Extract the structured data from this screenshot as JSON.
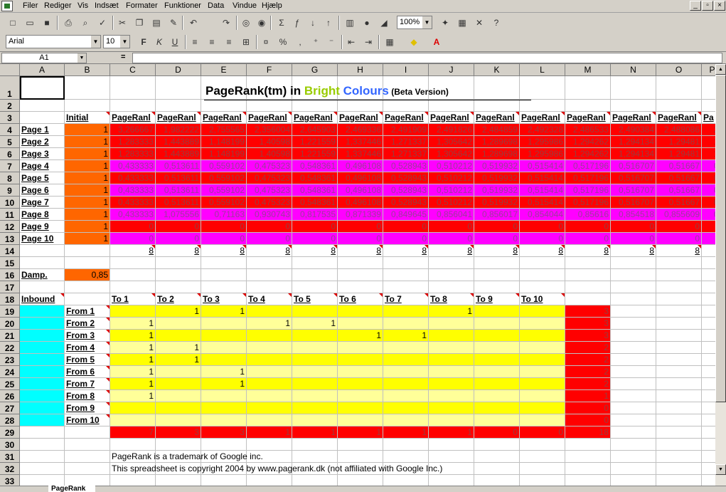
{
  "menu": [
    "Filer",
    "Rediger",
    "Vis",
    "Indsæt",
    "Formater",
    "Funktioner",
    "Data",
    "Vindue",
    "Hjælp"
  ],
  "window_controls": [
    "_",
    "▫",
    "×"
  ],
  "toolbar": {
    "zoom": "100%",
    "font": "Arial",
    "font_size": "10"
  },
  "formula_bar": {
    "name_box": "A1",
    "equals": "=",
    "value": ""
  },
  "columns": [
    "A",
    "B",
    "C",
    "D",
    "E",
    "F",
    "G",
    "H",
    "I",
    "J",
    "K",
    "L",
    "M",
    "N",
    "O",
    "P"
  ],
  "rows": [
    "1",
    "2",
    "3",
    "4",
    "5",
    "6",
    "7",
    "8",
    "9",
    "10",
    "11",
    "12",
    "13",
    "14",
    "15",
    "16",
    "17",
    "18",
    "19",
    "20",
    "21",
    "22",
    "23",
    "24",
    "25",
    "26",
    "27",
    "28",
    "29",
    "30",
    "31",
    "32",
    "33"
  ],
  "title": {
    "part1": "PageRank(tm) in ",
    "bright": "Bright",
    "space": " ",
    "colours": "Colours",
    "beta": " (Beta Version)"
  },
  "colors": {
    "bright": "#99cc00",
    "colours": "#3366ff",
    "red": "#ff0000",
    "magenta": "#ff00ff",
    "orange": "#ff6600",
    "cyan": "#00ffff",
    "yellow": "#ffff00",
    "light_yellow": "#ffff99"
  },
  "header_row": {
    "initial": "Initial",
    "pagerank_label": "PageRanl",
    "pagerank_last": "Pa"
  },
  "pages": [
    "Page 1",
    "Page 2",
    "Page 3",
    "Page 4",
    "Page 5",
    "Page 6",
    "Page 7",
    "Page 8",
    "Page 9",
    "Page 10"
  ],
  "initial_values": [
    "1",
    "1",
    "1",
    "1",
    "1",
    "1",
    "1",
    "1",
    "1",
    "1"
  ],
  "pagerank_values": [
    [
      "3,266667",
      "1,982222",
      "2,755565",
      "2,356004",
      "2,645903",
      "2,469336",
      "2,491909",
      "2,491826",
      "2,484859",
      "2,492328",
      "2,486533",
      "2,490384",
      "2,488086",
      "2,"
    ],
    [
      "1,283333",
      "1,443889",
      "1,148199",
      "1,40598",
      "1,221559",
      "1,337446",
      "1,271337",
      "1,305642",
      "1,289698",
      "1,295986",
      "1,294262",
      "1,294134",
      "1,29481",
      "1,"
    ],
    [
      "1,283333",
      "1,443889",
      "1,148199",
      "1,40598",
      "1,221559",
      "1,337446",
      "1,271337",
      "1,305642",
      "1,289698",
      "1,295986",
      "1,294262",
      "1,294134",
      "1,29481",
      "1,"
    ],
    [
      "0,433333",
      "0,513611",
      "0,559102",
      "0,475323",
      "0,548361",
      "0,496108",
      "0,528943",
      "0,510212",
      "0,519932",
      "0,515414",
      "0,517196",
      "0,516707",
      "0,51667",
      "0,"
    ],
    [
      "0,433333",
      "0,513611",
      "0,559102",
      "0,475323",
      "0,548361",
      "0,496108",
      "0,528943",
      "0,510212",
      "0,519932",
      "0,515414",
      "0,517196",
      "0,516707",
      "0,51667",
      "0,"
    ],
    [
      "0,433333",
      "0,513611",
      "0,559102",
      "0,475323",
      "0,548361",
      "0,496108",
      "0,528943",
      "0,510212",
      "0,519932",
      "0,515414",
      "0,517196",
      "0,516707",
      "0,51667",
      "0,"
    ],
    [
      "0,433333",
      "0,513611",
      "0,559102",
      "0,475323",
      "0,548361",
      "0,496108",
      "0,528943",
      "0,510212",
      "0,519932",
      "0,515414",
      "0,517196",
      "0,516707",
      "0,51667",
      "0,"
    ],
    [
      "0,433333",
      "1,075556",
      "0,71163",
      "0,930743",
      "0,817535",
      "0,871339",
      "0,849645",
      "0,856041",
      "0,856017",
      "0,854044",
      "0,85616",
      "0,854518",
      "0,855609",
      "0,"
    ],
    [
      "0",
      "0",
      "0",
      "0",
      "0",
      "0",
      "0",
      "0",
      "0",
      "0",
      "0",
      "0",
      "0",
      ""
    ],
    [
      "0",
      "0",
      "0",
      "0",
      "0",
      "0",
      "0",
      "0",
      "0",
      "0",
      "0",
      "0",
      "0",
      ""
    ]
  ],
  "sum_row": [
    "8",
    "8",
    "8",
    "8",
    "8",
    "8",
    "8",
    "8",
    "8",
    "8",
    "8",
    "8",
    "8"
  ],
  "damp": {
    "label": "Damp.",
    "value": "0,85"
  },
  "inbound": {
    "label": "Inbound",
    "to": [
      "To 1",
      "To 2",
      "To 3",
      "To 4",
      "To 5",
      "To 6",
      "To 7",
      "To 8",
      "To 9",
      "To 10"
    ],
    "from": [
      "From 1",
      "From 2",
      "From 3",
      "From 4",
      "From 5",
      "From 6",
      "From 7",
      "From 8",
      "From 9",
      "From 10"
    ],
    "matrix": [
      [
        "",
        "1",
        "1",
        "",
        "",
        "",
        "",
        "1",
        "",
        ""
      ],
      [
        "1",
        "",
        "",
        "1",
        "1",
        "",
        "",
        "",
        "",
        ""
      ],
      [
        "1",
        "",
        "",
        "",
        "",
        "1",
        "1",
        "",
        "",
        ""
      ],
      [
        "1",
        "1",
        "",
        "",
        "",
        "",
        "",
        "",
        "",
        ""
      ],
      [
        "1",
        "1",
        "",
        "",
        "",
        "",
        "",
        "",
        "",
        ""
      ],
      [
        "1",
        "",
        "1",
        "",
        "",
        "",
        "",
        "",
        "",
        ""
      ],
      [
        "1",
        "",
        "1",
        "",
        "",
        "",
        "",
        "",
        "",
        ""
      ],
      [
        "1",
        "",
        "",
        "",
        "",
        "",
        "",
        "",
        "",
        ""
      ],
      [
        "",
        "",
        "",
        "",
        "",
        "",
        "",
        "",
        "",
        ""
      ],
      [
        "",
        "",
        "",
        "",
        "",
        "",
        "",
        "",
        "",
        ""
      ]
    ],
    "row_totals": [
      "3",
      "3",
      "3",
      "2",
      "2",
      "2",
      "2",
      "1",
      "0",
      "0"
    ],
    "col_totals": [
      "7",
      "3",
      "3",
      "1",
      "1",
      "1",
      "1",
      "1",
      "0",
      "0"
    ],
    "grand_total": "18"
  },
  "notes": [
    "PageRank is a trademark of Google inc.",
    "This spreadsheet is copyright 2004 by www.pagerank.dk (not affiliated with Google Inc.)"
  ],
  "sheet_tab": "PageRank"
}
